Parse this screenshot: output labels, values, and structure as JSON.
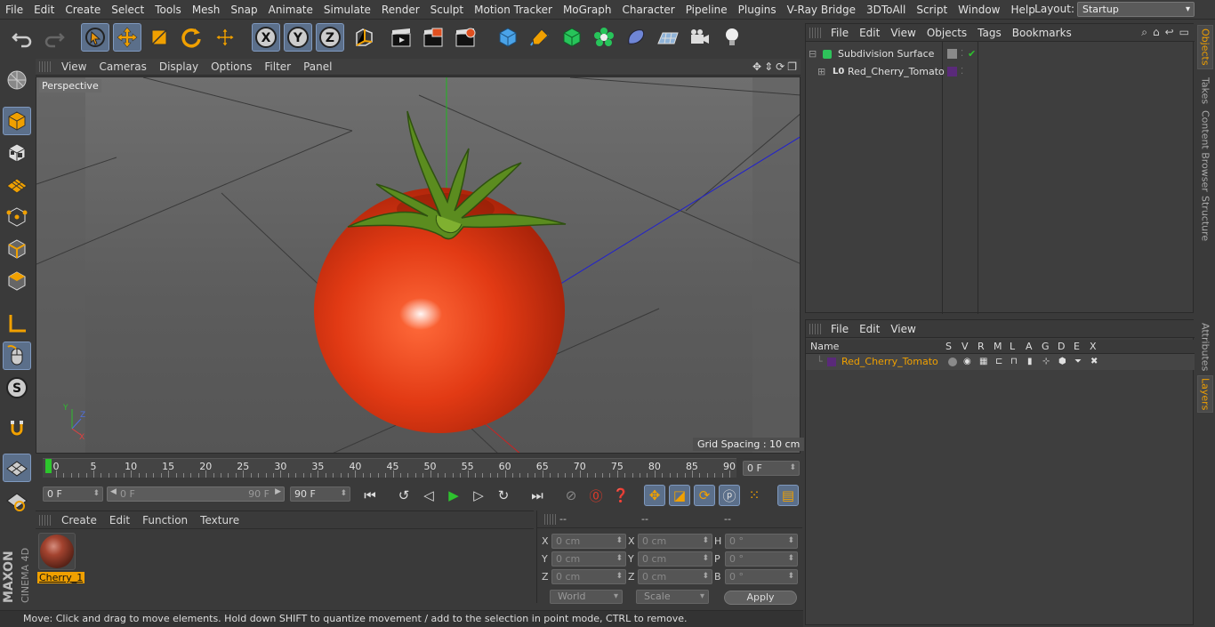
{
  "menubar": {
    "items": [
      "File",
      "Edit",
      "Create",
      "Select",
      "Tools",
      "Mesh",
      "Snap",
      "Animate",
      "Simulate",
      "Render",
      "Sculpt",
      "Motion Tracker",
      "MoGraph",
      "Character",
      "Pipeline",
      "Plugins",
      "V-Ray Bridge",
      "3DToAll",
      "Script",
      "Window",
      "Help"
    ],
    "layout_label": "Layout:",
    "layout_value": "Startup"
  },
  "viewport": {
    "menu": [
      "View",
      "Cameras",
      "Display",
      "Options",
      "Filter",
      "Panel"
    ],
    "camera": "Perspective",
    "grid_spacing": "Grid Spacing : 10 cm"
  },
  "timeline": {
    "ticks": [
      "0",
      "5",
      "10",
      "15",
      "20",
      "25",
      "30",
      "35",
      "40",
      "45",
      "50",
      "55",
      "60",
      "65",
      "70",
      "75",
      "80",
      "85",
      "90"
    ],
    "current_frame": "0 F",
    "start_frame": "0 F",
    "range_start": "0 F",
    "range_end": "90 F",
    "end_frame": "90 F"
  },
  "material_panel": {
    "menu": [
      "Create",
      "Edit",
      "Function",
      "Texture"
    ],
    "material_name": "Cherry_1"
  },
  "coords": {
    "headers": [
      "--",
      "--",
      "--"
    ],
    "pos_x": "0 cm",
    "pos_y": "0 cm",
    "pos_z": "0 cm",
    "size_x": "0 cm",
    "size_y": "0 cm",
    "size_z": "0 cm",
    "rot_h": "0 °",
    "rot_p": "0 °",
    "rot_b": "0 °",
    "labels": [
      "X",
      "Y",
      "Z",
      "X",
      "Y",
      "Z",
      "H",
      "P",
      "B"
    ],
    "mode_world": "World",
    "mode_scale": "Scale",
    "apply": "Apply"
  },
  "objects_panel": {
    "menu": [
      "File",
      "Edit",
      "View",
      "Objects",
      "Tags",
      "Bookmarks"
    ],
    "items": [
      "Subdivision Surface",
      "Red_Cherry_Tomato"
    ]
  },
  "layers_panel": {
    "menu": [
      "File",
      "Edit",
      "View"
    ],
    "columns": [
      "Name",
      "S",
      "V",
      "R",
      "M",
      "L",
      "A",
      "G",
      "D",
      "E",
      "X"
    ],
    "layer_name": "Red_Cherry_Tomato"
  },
  "right_tabs": [
    "Objects",
    "Takes",
    "Content Browser",
    "Structure",
    "Attributes",
    "Layers"
  ],
  "status": "Move: Click and drag to move elements. Hold down SHIFT to quantize movement / add to the selection in point mode, CTRL to remove.",
  "logo": {
    "line1": "MAXON",
    "line2": "CINEMA 4D"
  },
  "colors": {
    "accent": "#f0a000",
    "selection": "#5b6f8a",
    "tomato": "#e0391a"
  }
}
